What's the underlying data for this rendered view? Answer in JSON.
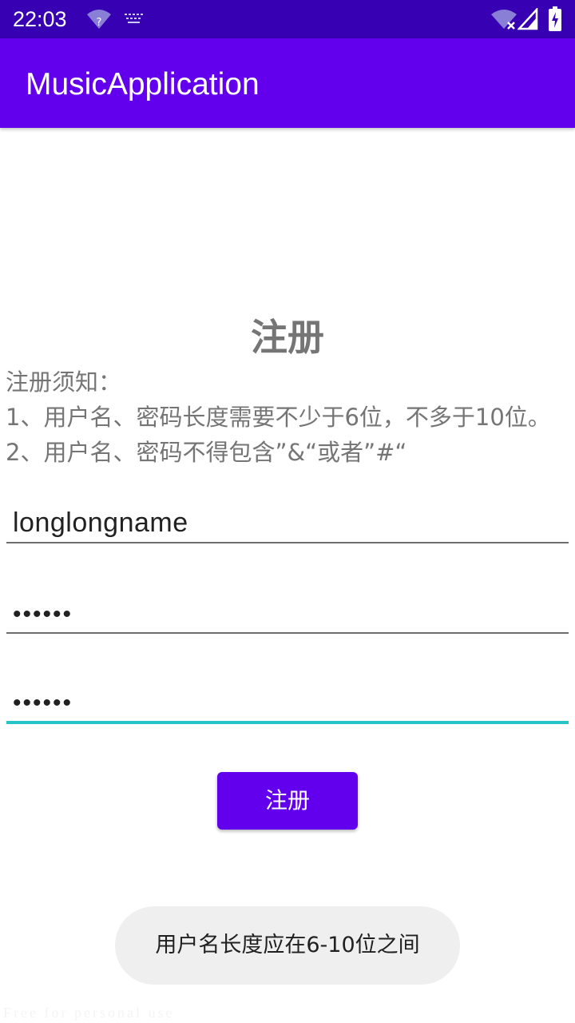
{
  "status_bar": {
    "time": "22:03",
    "icons": [
      "wifi-unknown-icon",
      "keyboard-icon",
      "wifi-off-icon",
      "signal-icon",
      "battery-charging-icon"
    ]
  },
  "app_bar": {
    "title": "MusicApplication"
  },
  "page": {
    "title": "注册",
    "notice_lines": [
      "注册须知：",
      "1、用户名、密码长度需要不少于6位，不多于10位。",
      "2、用户名、密码不得包含”&“或者”#“"
    ]
  },
  "form": {
    "username_value": "longlongname",
    "password_value": "••••••",
    "confirm_password_value": "••••••",
    "register_label": "注册"
  },
  "toast": {
    "message": "用户名长度应在6-10位之间"
  },
  "watermark": {
    "text": "Free for personal use"
  },
  "colors": {
    "primary": "#6200ee",
    "primary_dark": "#3700b3",
    "accent": "#26c6c6",
    "text_secondary": "#757575"
  }
}
